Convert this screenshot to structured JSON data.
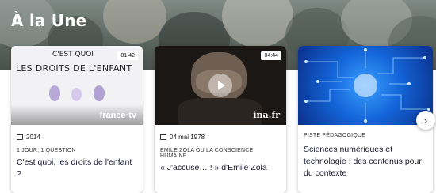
{
  "section": {
    "title": "À la Une"
  },
  "cards": [
    {
      "duration": "01:42",
      "thumb_text_line1": "C'EST QUOI",
      "thumb_text_line2": "LES DROITS DE L'ENFANT",
      "watermark": "france·tv",
      "date": "2014",
      "kicker": "1 JOUR, 1 QUESTION",
      "title": "C'est quoi, les droits de l'enfant ?"
    },
    {
      "duration": "04:44",
      "watermark": "ina.fr",
      "date": "04 mai 1978",
      "kicker": "EMILE ZOLA OU LA CONSCIENCE HUMAINE",
      "title": "« J'accuse… ! » d'Emile Zola"
    },
    {
      "kicker": "PISTE PÉDAGOGIQUE",
      "title": "Sciences numériques et technologie : des contenus pour du contexte"
    }
  ],
  "navigation": {
    "next_icon": "chevron-right-icon"
  }
}
